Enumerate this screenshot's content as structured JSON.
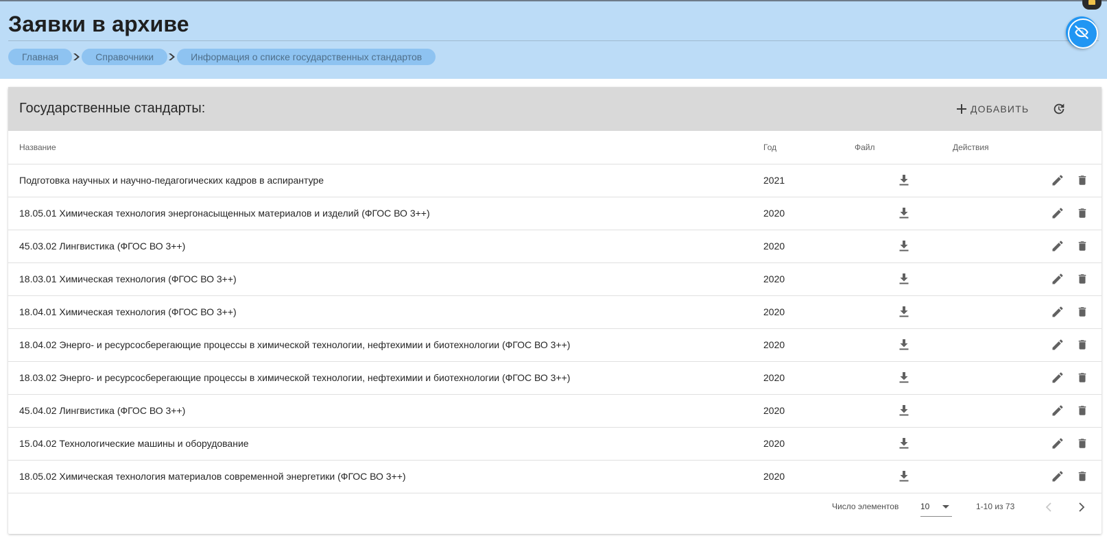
{
  "page": {
    "title": "Заявки в архиве"
  },
  "breadcrumb": {
    "items": [
      {
        "label": "Главная"
      },
      {
        "label": "Справочники"
      },
      {
        "label": "Информация о списке государственных стандартов"
      }
    ]
  },
  "card": {
    "title": "Государственные стандарты:",
    "add_label": "ДОБАВИТЬ",
    "add_icon": "plus-icon",
    "refresh_icon": "refresh-icon"
  },
  "table": {
    "columns": {
      "name": "Название",
      "year": "Год",
      "file": "Файл",
      "actions": "Действия"
    },
    "rows": [
      {
        "name": "Подготовка научных и научно-педагогических кадров в аспирантуре",
        "year": "2021"
      },
      {
        "name": "18.05.01 Химическая технология энергонасыщенных материалов и изделий (ФГОС ВО 3++)",
        "year": "2020"
      },
      {
        "name": "45.03.02 Лингвистика (ФГОС ВО 3++)",
        "year": "2020"
      },
      {
        "name": "18.03.01 Химическая технология (ФГОС ВО 3++)",
        "year": "2020"
      },
      {
        "name": "18.04.01 Химическая технология (ФГОС ВО 3++)",
        "year": "2020"
      },
      {
        "name": "18.04.02 Энерго- и ресурсосберегающие процессы в химической технологии, нефтехимии и биотехнологии (ФГОС ВО 3++)",
        "year": "2020"
      },
      {
        "name": "18.03.02 Энерго- и ресурсосберегающие процессы в химической технологии, нефтехимии и биотехнологии (ФГОС ВО 3++)",
        "year": "2020"
      },
      {
        "name": "45.04.02 Лингвистика (ФГОС ВО 3++)",
        "year": "2020"
      },
      {
        "name": "15.04.02 Технологические машины и оборудование",
        "year": "2020"
      },
      {
        "name": "18.05.02 Химическая технология материалов современной энергетики (ФГОС ВО 3++)",
        "year": "2020"
      }
    ]
  },
  "paginator": {
    "page_size_label": "Число элементов",
    "page_size": "10",
    "range_label": "1-10 из 73"
  },
  "colors": {
    "header_band": "#bcdcf7",
    "breadcrumb_chip": "#8ec3f1",
    "card_header": "#d9d9d9",
    "fab": "#2196f3",
    "icon": "#616161"
  }
}
